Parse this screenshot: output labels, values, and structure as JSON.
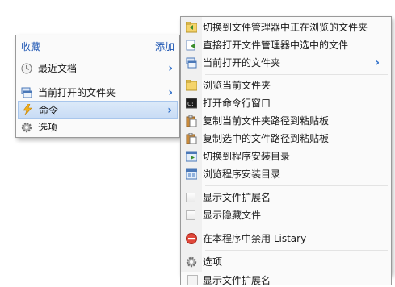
{
  "left_menu": {
    "header_title": "收藏",
    "header_action": "添加",
    "items": [
      {
        "label": "最近文档",
        "icon": "clock-icon",
        "submenu": true
      },
      {
        "label": "当前打开的文件夹",
        "icon": "windows-stack-icon",
        "submenu": true
      },
      {
        "label": "命令",
        "icon": "lightning-icon",
        "submenu": true,
        "highlighted": true
      },
      {
        "label": "选项",
        "icon": "gear-icon",
        "submenu": false
      }
    ]
  },
  "right_menu": {
    "items": [
      {
        "label": "切换到文件管理器中正在浏览的文件夹",
        "icon": "folder-switch-icon"
      },
      {
        "label": "直接打开文件管理器中选中的文件",
        "icon": "open-file-icon"
      },
      {
        "label": "当前打开的文件夹",
        "icon": "windows-stack-icon",
        "submenu": true
      },
      {
        "label": "浏览当前文件夹",
        "icon": "folder-browse-icon"
      },
      {
        "label": "打开命令行窗口",
        "icon": "terminal-icon"
      },
      {
        "label": "复制当前文件夹路径到粘贴板",
        "icon": "clipboard-icon"
      },
      {
        "label": "复制选中的文件路径到粘贴板",
        "icon": "clipboard-icon"
      },
      {
        "label": "切换到程序安装目录",
        "icon": "program-folder-switch-icon"
      },
      {
        "label": "浏览程序安装目录",
        "icon": "program-folder-browse-icon"
      },
      {
        "label": "显示文件扩展名",
        "icon": "checkbox-icon"
      },
      {
        "label": "显示隐藏文件",
        "icon": "checkbox-icon"
      },
      {
        "label": "在本程序中禁用 Listary",
        "icon": "disable-icon"
      },
      {
        "label": "选项",
        "icon": "gear-icon"
      }
    ],
    "ghost_item": "显示文件扩展名"
  },
  "colors": {
    "accent": "#1e56b3",
    "chevron": "#2f6fc9",
    "highlight": "#c9dcf5",
    "menu_bg": "#fafafa"
  }
}
